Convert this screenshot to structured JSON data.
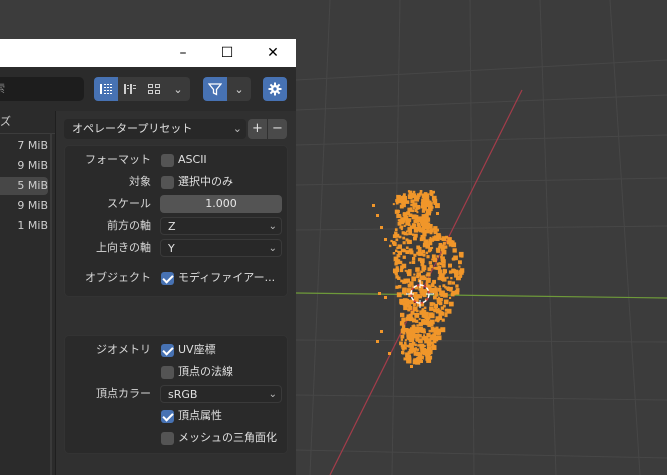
{
  "dialog": {
    "window_controls": {
      "minimize": "–",
      "maximize": "☐",
      "close": "✕"
    },
    "search_placeholder": "索",
    "filelist": {
      "header": "ズ",
      "sizes": [
        "7 MiB",
        "9 MiB",
        "5 MiB",
        "9 MiB",
        "1 MiB"
      ],
      "selected_index": 2
    },
    "preset": {
      "label": "オペレータープリセット",
      "add": "+",
      "remove": "−"
    },
    "format": {
      "label": "フォーマット",
      "value": "ASCII",
      "checked": false
    },
    "target": {
      "label": "対象",
      "value": "選択中のみ",
      "checked": false
    },
    "scale": {
      "label": "スケール",
      "value": "1.000"
    },
    "forward_axis": {
      "label": "前方の軸",
      "value": "Z"
    },
    "up_axis": {
      "label": "上向きの軸",
      "value": "Y"
    },
    "object": {
      "label": "オブジェクト",
      "value": "モディファイアー...",
      "checked": true
    },
    "geometry": {
      "label": "ジオメトリ",
      "uv": {
        "value": "UV座標",
        "checked": true
      },
      "normals": {
        "value": "頂点の法線",
        "checked": false
      }
    },
    "vertex_color": {
      "label": "頂点カラー",
      "value": "sRGB"
    },
    "vertex_attr": {
      "value": "頂点属性",
      "checked": true
    },
    "triangulate": {
      "value": "メッシュの三角面化",
      "checked": false
    }
  },
  "colors": {
    "accent_blue": "#4772b3",
    "point_cloud": "#f0962a",
    "x_axis": "#a33c4a",
    "y_axis": "#6e9a3a"
  },
  "icons": {
    "view_thumbnails": "list-vertical-icon",
    "view_list": "list-horizontal-icon",
    "view_grid": "grid-icon",
    "filter": "funnel-icon",
    "settings": "gear-icon"
  }
}
